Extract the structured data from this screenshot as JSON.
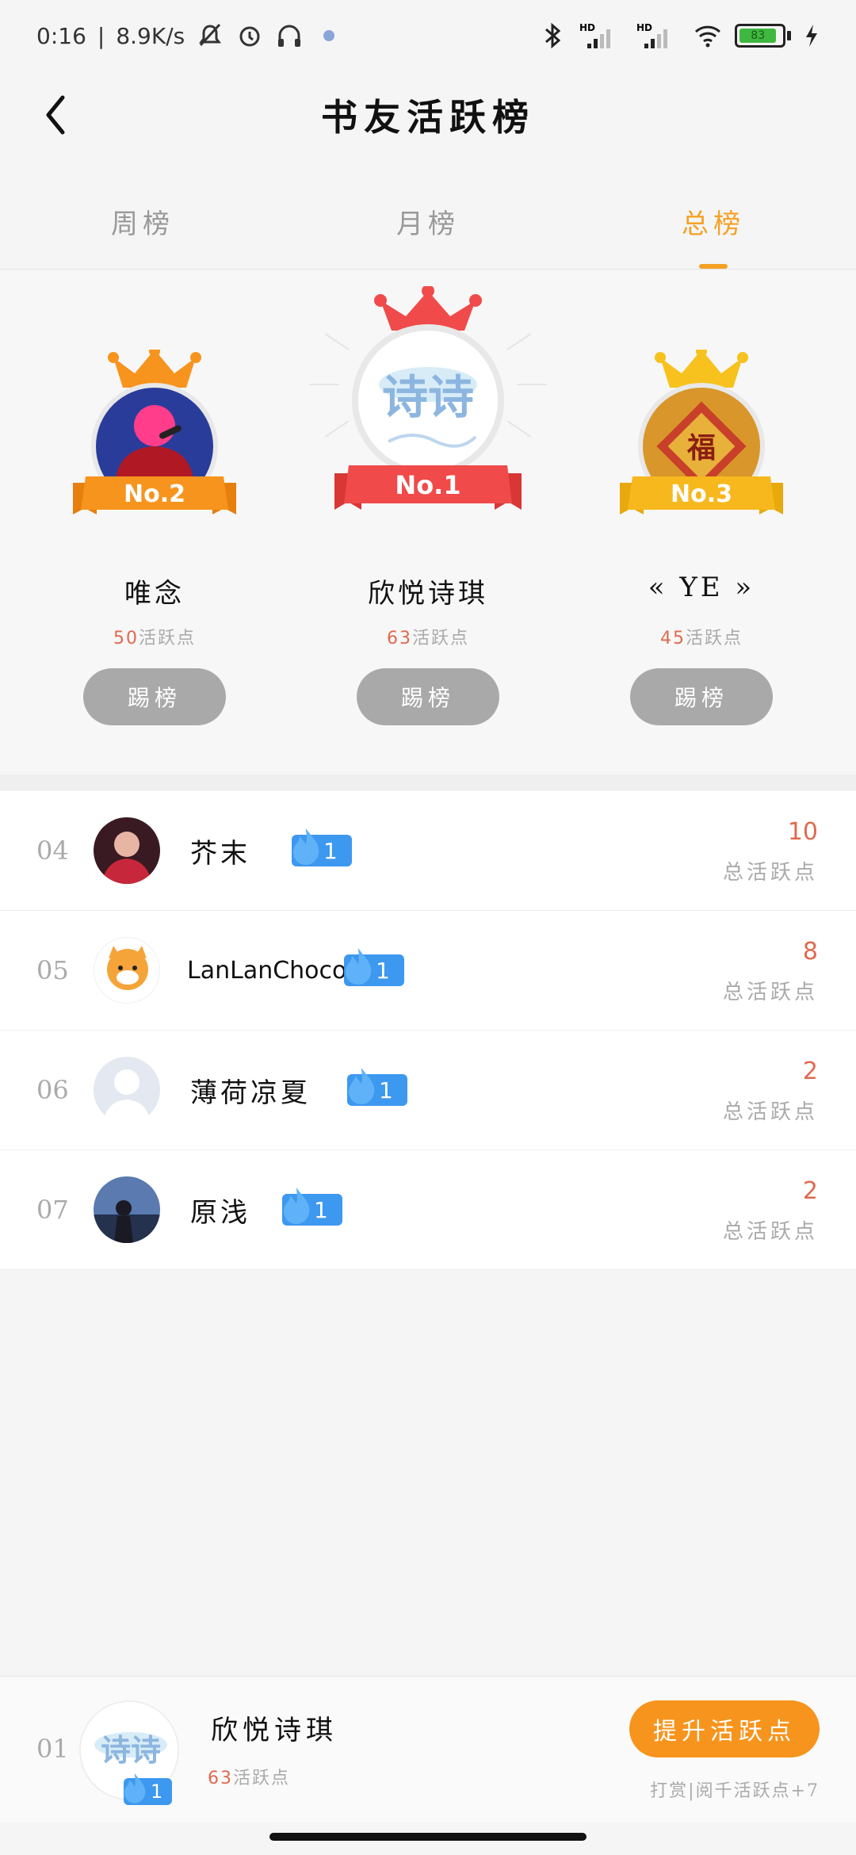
{
  "status_bar": {
    "time": "0:16",
    "speed": "8.9K/s",
    "battery": "83"
  },
  "header": {
    "title": "书友活跃榜"
  },
  "tabs": [
    {
      "label": "周榜",
      "active": false
    },
    {
      "label": "月榜",
      "active": false
    },
    {
      "label": "总榜",
      "active": true
    }
  ],
  "podium": {
    "first": {
      "rank_label": "No.1",
      "name": "欣悦诗琪",
      "points": "63",
      "points_suffix": "活跃点",
      "button": "踢榜",
      "avatar_text": "诗诗"
    },
    "second": {
      "rank_label": "No.2",
      "name": "唯念",
      "points": "50",
      "points_suffix": "活跃点",
      "button": "踢榜"
    },
    "third": {
      "rank_label": "No.3",
      "name": "« YE »",
      "points": "45",
      "points_suffix": "活跃点",
      "button": "踢榜"
    }
  },
  "list": [
    {
      "rank": "04",
      "name": "芥末",
      "level": "1",
      "score": "10",
      "score_label": "总活跃点"
    },
    {
      "rank": "05",
      "name": "LanLanChoco",
      "level": "1",
      "score": "8",
      "score_label": "总活跃点"
    },
    {
      "rank": "06",
      "name": "薄荷凉夏",
      "level": "1",
      "score": "2",
      "score_label": "总活跃点"
    },
    {
      "rank": "07",
      "name": "原浅",
      "level": "1",
      "score": "2",
      "score_label": "总活跃点"
    }
  ],
  "me": {
    "rank": "01",
    "name": "欣悦诗琪",
    "level": "1",
    "points": "63",
    "points_suffix": "活跃点",
    "boost_button": "提升活跃点",
    "hint": "打赏|阅千活跃点+7",
    "avatar_text": "诗诗"
  },
  "colors": {
    "accent": "#f5a124",
    "boost": "#f7941d",
    "score": "#e0694f",
    "level_badge": "#3d98ef"
  }
}
